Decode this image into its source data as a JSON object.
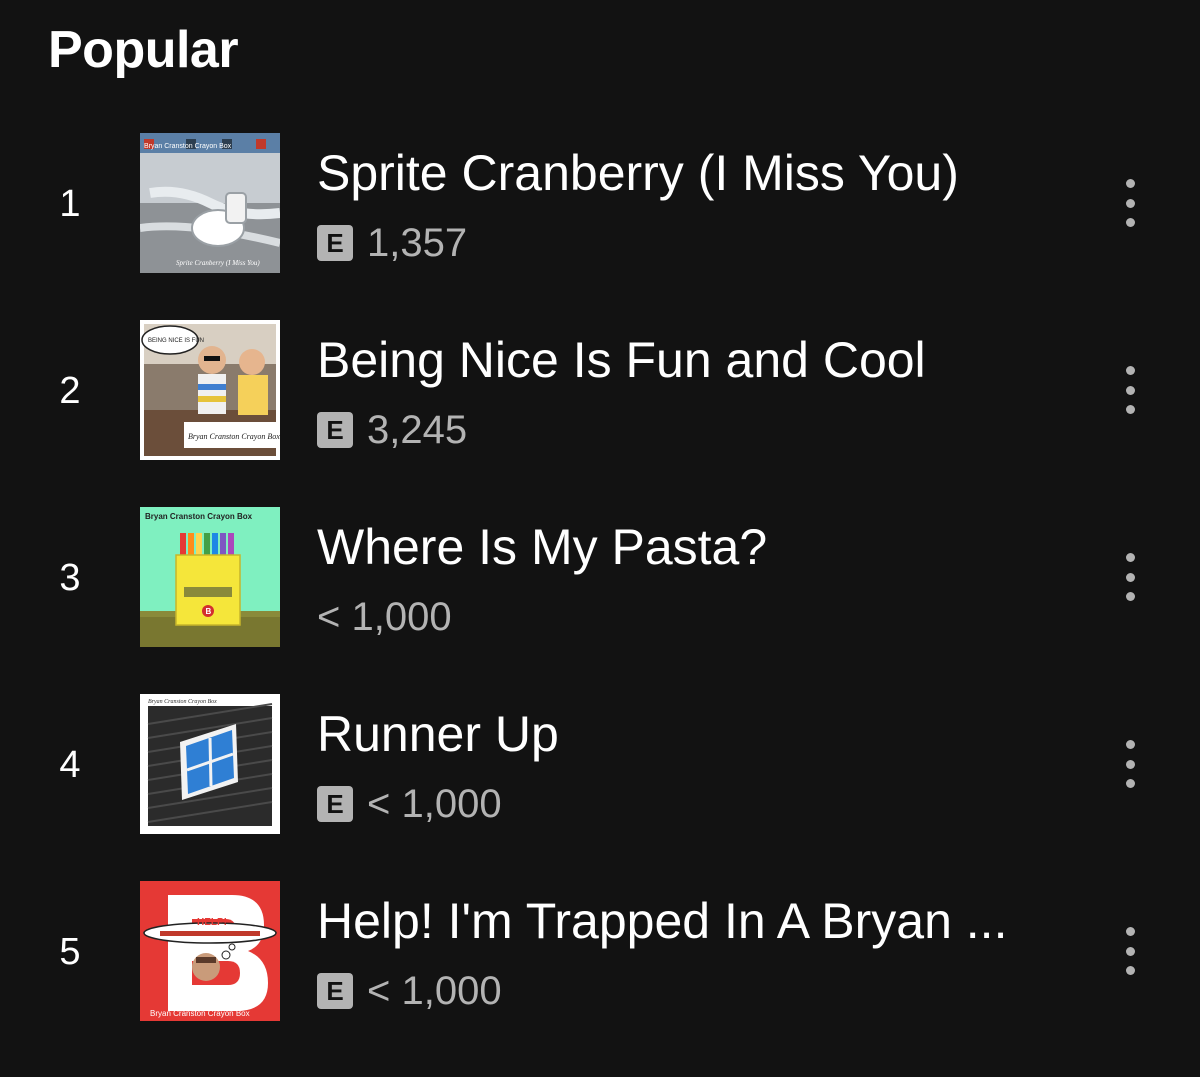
{
  "section": {
    "title": "Popular"
  },
  "tracks": [
    {
      "index": "1",
      "title": "Sprite Cranberry (I Miss You)",
      "explicit": true,
      "explicit_label": "E",
      "plays": "1,357",
      "cover": {
        "header_text": "Bryan Cranston Crayon Box",
        "footer_text": "Sprite Cranberry (I Miss You)"
      }
    },
    {
      "index": "2",
      "title": "Being Nice Is Fun and Cool",
      "explicit": true,
      "explicit_label": "E",
      "plays": "3,245",
      "cover": {
        "header_text": "BEING NICE IS FUN",
        "footer_text": "Bryan Cranston Crayon Box"
      }
    },
    {
      "index": "3",
      "title": "Where Is My Pasta?",
      "explicit": false,
      "explicit_label": "",
      "plays": "< 1,000",
      "cover": {
        "header_text": "Bryan Cranston Crayon Box",
        "badge_letter": "B"
      }
    },
    {
      "index": "4",
      "title": "Runner Up",
      "explicit": true,
      "explicit_label": "E",
      "plays": "< 1,000",
      "cover": {
        "header_text": "Bryan Cranston Crayon Box"
      }
    },
    {
      "index": "5",
      "title": "Help! I'm Trapped In A Bryan ...",
      "explicit": true,
      "explicit_label": "E",
      "plays": "< 1,000",
      "cover": {
        "banner_text": "HELP!",
        "footer_text": "Bryan Cranston Crayon Box"
      }
    }
  ],
  "colors": {
    "background": "#121212",
    "text_primary": "#ffffff",
    "text_secondary": "#b3b3b3"
  }
}
